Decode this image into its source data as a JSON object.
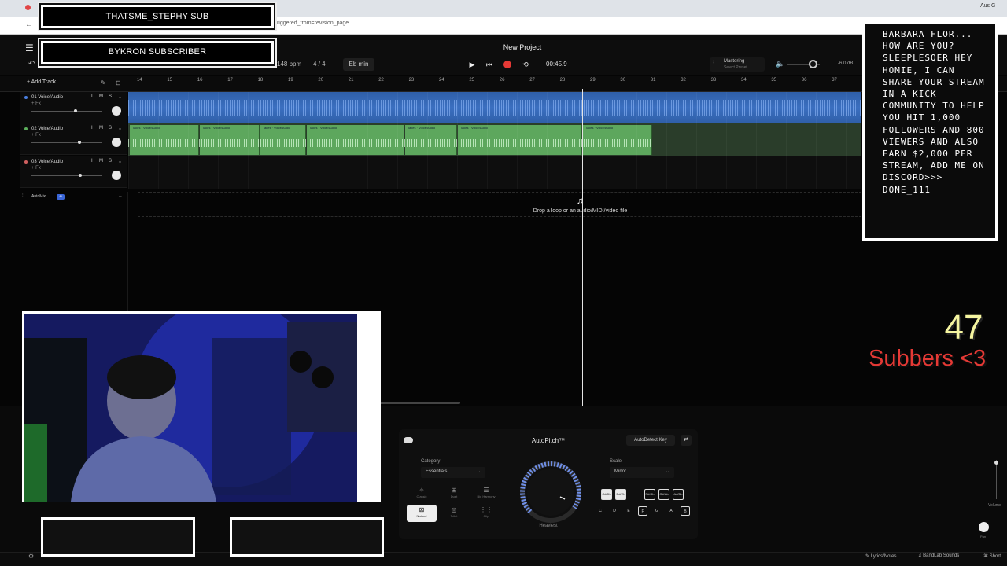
{
  "browser": {
    "url_fragment": "triggered_from=revision_page",
    "extension_badge": "Aus G"
  },
  "daw": {
    "project_title": "New Project",
    "tempo": "148 bpm",
    "time_signature": "4 / 4",
    "key": "Eb min",
    "time": "00:45.9",
    "mastering_label": "Mastering",
    "mastering_preset": "Select Preset",
    "master_db": "-6.0 dB",
    "add_track_label": "+ Add Track",
    "ruler_ticks": [
      "14",
      "15",
      "16",
      "17",
      "18",
      "19",
      "20",
      "21",
      "22",
      "23",
      "24",
      "25",
      "26",
      "27",
      "28",
      "29",
      "30",
      "31",
      "32",
      "33",
      "34",
      "35",
      "36",
      "37"
    ],
    "tracks": [
      {
        "name": "01 Voice/Audio",
        "fx": "+ Fx",
        "color": "#4a7fe0"
      },
      {
        "name": "02 Voice/Audio",
        "fx": "+ Fx",
        "color": "#5db05d"
      },
      {
        "name": "03 Voice/Audio",
        "fx": "+ Fx",
        "color": "#d06060"
      }
    ],
    "clip_label": "Takes · Voice/Audio",
    "automix_label": "AutoMix",
    "automix_badge": "AI",
    "drop_text": "Drop a loop or an audio/MIDI/video file"
  },
  "autopitch": {
    "title": "AutoPitch™",
    "autodetect": "AutoDetect Key",
    "category_label": "Category",
    "category_value": "Essentials",
    "styles": [
      {
        "icon": "✧",
        "name": "Classic"
      },
      {
        "icon": "⊞",
        "name": "Duet"
      },
      {
        "icon": "☰",
        "name": "Big Harmony"
      },
      {
        "icon": "⊠",
        "name": "Natural"
      },
      {
        "icon": "◎",
        "name": "Tribit"
      },
      {
        "icon": "⋮⋮",
        "name": "Clip"
      }
    ],
    "dial_label": "Heaviest",
    "scale_label": "Scale",
    "scale_value": "Minor",
    "black_keys": [
      "C#/Db",
      "D#/Eb",
      "F#/Gb",
      "G#/Ab",
      "A#/Bb"
    ],
    "white_keys": [
      "C",
      "D",
      "E",
      "F",
      "G",
      "A",
      "B"
    ],
    "volume_label": "Volume",
    "pan_label": "Pan"
  },
  "footer": {
    "lyrics": "Lyrics/Notes",
    "sounds": "BandLab Sounds",
    "shortcuts": "Short"
  },
  "overlay": {
    "sub_1": "THATSME_STEPHY SUB",
    "sub_2": "BYKRON SUBSCRIBER",
    "chat": "BARBARA_FLOR... HOW ARE YOU? SLEEPLESQER HEY HOMIE, I CAN SHARE YOUR STREAM IN A KICK COMMUNITY TO HELP YOU HIT 1,000 FOLLOWERS AND 800 VIEWERS AND ALSO EARN $2,000 PER STREAM, ADD ME ON DISCORD>>> DONE_111",
    "goal_count": "47",
    "goal_label": "Subbers <3"
  }
}
